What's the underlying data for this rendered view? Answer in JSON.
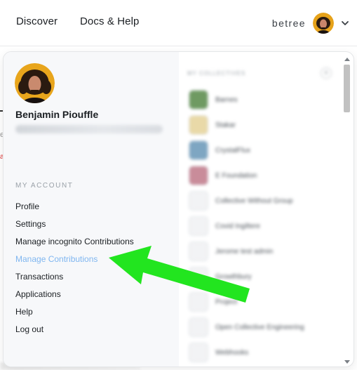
{
  "nav": {
    "discover": "Discover",
    "docs_help": "Docs & Help",
    "username": "betree",
    "icons": {
      "chevron": "chevron-down-icon"
    }
  },
  "profile": {
    "name": "Benjamin Piouffle",
    "email_redacted": true
  },
  "account_menu": {
    "title": "MY ACCOUNT",
    "items": [
      {
        "label": "Profile",
        "active": false
      },
      {
        "label": "Settings",
        "active": false
      },
      {
        "label": "Manage incognito Contributions",
        "active": false
      },
      {
        "label": "Manage Contributions",
        "active": true
      },
      {
        "label": "Transactions",
        "active": false
      },
      {
        "label": "Applications",
        "active": false
      },
      {
        "label": "Help",
        "active": false
      },
      {
        "label": "Log out",
        "active": false
      }
    ]
  },
  "collectives_pane": {
    "blurred": true,
    "header": "MY COLLECTIVES",
    "items": [
      {
        "name": "Barnes",
        "color": "#6f9a62"
      },
      {
        "name": "Stakar",
        "color": "#e9d9a8"
      },
      {
        "name": "CrystalFlux",
        "color": "#7ea6c2"
      },
      {
        "name": "E Foundation",
        "color": "#c98c9a"
      },
      {
        "name": "Collective Without Group",
        "color": "#f2f3f5"
      },
      {
        "name": "Covid Ingiltere",
        "color": "#f2f3f5"
      },
      {
        "name": "Jerome test admin",
        "color": "#f2f3f5"
      },
      {
        "name": "Growthbury",
        "color": "#f2f3f5"
      },
      {
        "name": "Project",
        "color": "#f2f3f5"
      },
      {
        "name": "Open Collective Engineering",
        "color": "#f2f3f5"
      },
      {
        "name": "Webhooks",
        "color": "#f2f3f5"
      }
    ]
  },
  "annotation": {
    "arrow_color": "#22e51f",
    "points_to": "Manage Contributions"
  },
  "colors": {
    "active_link": "#7fb6f0",
    "panel_left_bg": "#f7f8fa",
    "border": "#e4e6e8"
  }
}
